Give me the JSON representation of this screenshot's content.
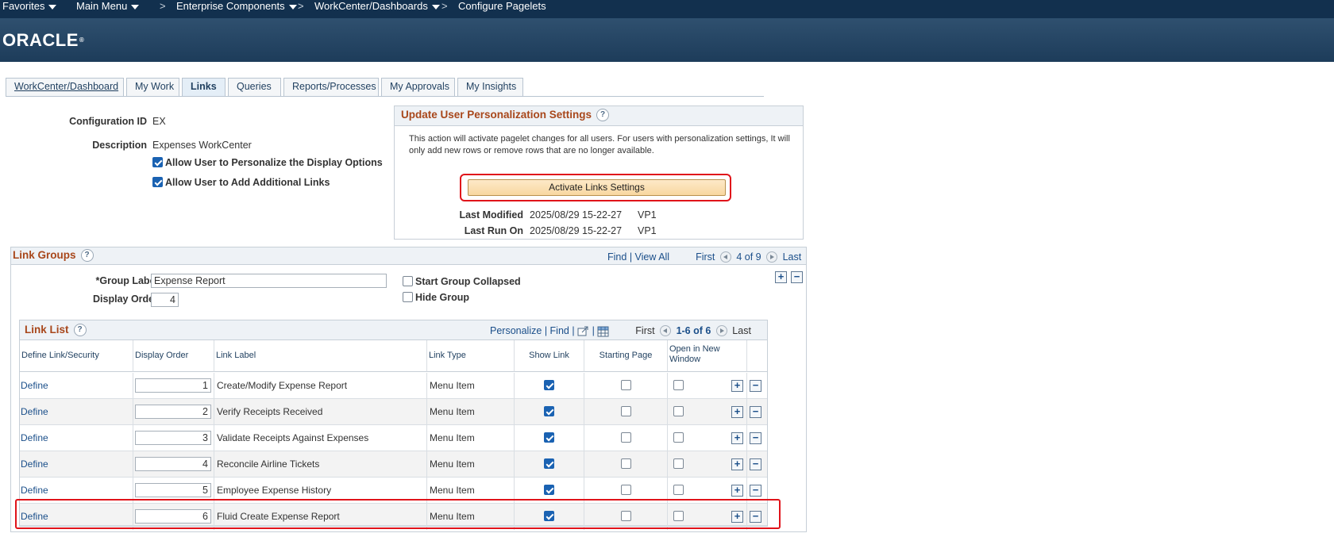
{
  "nav": {
    "favorites": "Favorites",
    "main_menu": "Main Menu",
    "sep": ">",
    "breadcrumbs": [
      "Enterprise Components",
      "WorkCenter/Dashboards",
      "Configure Pagelets"
    ]
  },
  "brand": {
    "logo": "ORACLE",
    "reg": "®"
  },
  "tabs": [
    {
      "label": "WorkCenter/Dashboard",
      "active": false
    },
    {
      "label": "My Work",
      "active": false
    },
    {
      "label": "Links",
      "active": true
    },
    {
      "label": "Queries",
      "active": false
    },
    {
      "label": "Reports/Processes",
      "active": false
    },
    {
      "label": "My Approvals",
      "active": false
    },
    {
      "label": "My Insights",
      "active": false
    }
  ],
  "config": {
    "id_label": "Configuration ID",
    "id_value": "EX",
    "desc_label": "Description",
    "desc_value": "Expenses WorkCenter",
    "allow_personalize": "Allow User to Personalize the Display Options",
    "allow_personalize_checked": true,
    "allow_add_links": "Allow User to Add Additional Links",
    "allow_add_links_checked": true
  },
  "personalization": {
    "title": "Update User Personalization Settings",
    "help": "?",
    "text": "This action will activate pagelet changes for all users.  For users with personalization settings, It will only add new rows or remove rows that are no longer available.",
    "button": "Activate Links Settings",
    "last_modified_label": "Last Modified",
    "last_modified_value": "2025/08/29 15-22-27",
    "last_modified_user": "VP1",
    "last_run_label": "Last Run On",
    "last_run_value": "2025/08/29 15-22-27",
    "last_run_user": "VP1"
  },
  "link_groups": {
    "title": "Link Groups",
    "help": "?",
    "find": "Find",
    "bar": "|",
    "view_all": "View All",
    "first": "First",
    "counter": "4 of 9",
    "last": "Last",
    "add": "+",
    "remove": "−",
    "group_label_label": "*Group Label",
    "group_label_value": "Expense Report",
    "display_order_label": "Display Order",
    "display_order_value": "4",
    "start_collapsed": "Start Group Collapsed",
    "start_collapsed_checked": false,
    "hide_group": "Hide Group",
    "hide_group_checked": false
  },
  "link_list": {
    "title": "Link List",
    "help": "?",
    "personalize": "Personalize",
    "find": "Find",
    "bar": "|",
    "first": "First",
    "counter": "1-6 of 6",
    "last": "Last",
    "columns": [
      "Define Link/Security",
      "Display Order",
      "Link Label",
      "Link Type",
      "Show Link",
      "Starting Page",
      "Open in New Window"
    ],
    "rows": [
      {
        "define": "Define",
        "order": "1",
        "label": "Create/Modify Expense Report",
        "type": "Menu Item",
        "show": true,
        "starting": false,
        "new_window": false
      },
      {
        "define": "Define",
        "order": "2",
        "label": "Verify Receipts Received",
        "type": "Menu Item",
        "show": true,
        "starting": false,
        "new_window": false
      },
      {
        "define": "Define",
        "order": "3",
        "label": "Validate Receipts Against Expenses",
        "type": "Menu Item",
        "show": true,
        "starting": false,
        "new_window": false
      },
      {
        "define": "Define",
        "order": "4",
        "label": "Reconcile Airline Tickets",
        "type": "Menu Item",
        "show": true,
        "starting": false,
        "new_window": false
      },
      {
        "define": "Define",
        "order": "5",
        "label": "Employee Expense History",
        "type": "Menu Item",
        "show": true,
        "starting": false,
        "new_window": false
      },
      {
        "define": "Define",
        "order": "6",
        "label": "Fluid Create Expense Report",
        "type": "Menu Item",
        "show": true,
        "starting": false,
        "new_window": false
      }
    ],
    "add": "+",
    "remove": "−"
  },
  "colors": {
    "nav_bg": "#12304e",
    "banner_bg": "#2f506f",
    "section_title": "#a8471b",
    "link": "#1b4f8a",
    "highlight": "#e0131a",
    "button_bg": "#fbe1b5"
  }
}
